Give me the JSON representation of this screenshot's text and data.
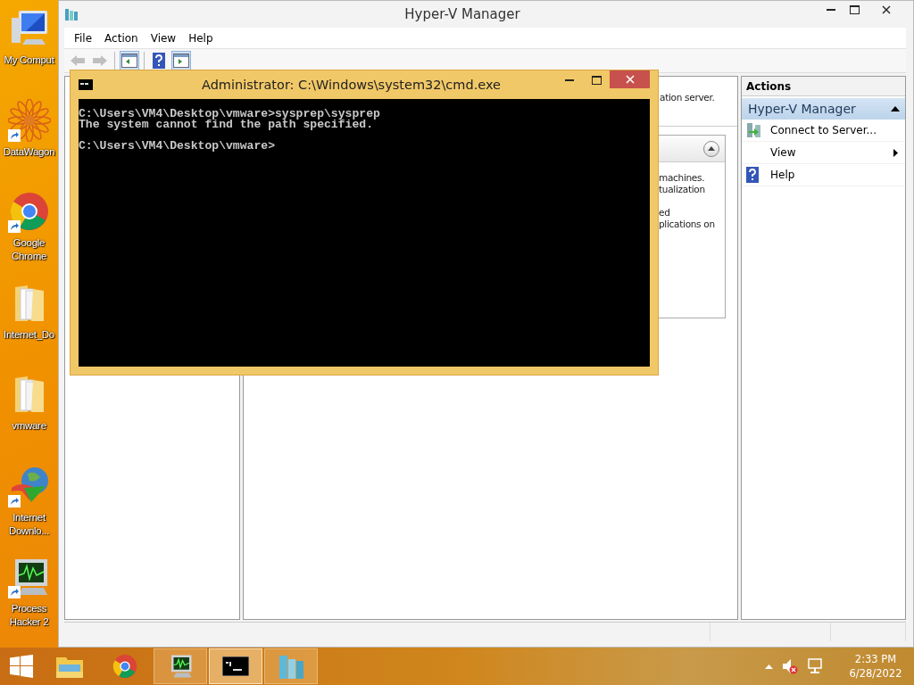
{
  "desktop_icons": [
    {
      "label": "My Comput",
      "kind": "computer",
      "shortcut": false
    },
    {
      "label": "DataWagon",
      "kind": "star",
      "shortcut": true
    },
    {
      "label": "Google Chrome",
      "kind": "chrome",
      "shortcut": true
    },
    {
      "label": "Internet_Do",
      "kind": "folder",
      "shortcut": false
    },
    {
      "label": "vmware",
      "kind": "folder",
      "shortcut": false
    },
    {
      "label": "Internet Downlo...",
      "kind": "globe",
      "shortcut": true
    },
    {
      "label": "Process Hacker 2",
      "kind": "monitor",
      "shortcut": true
    }
  ],
  "window": {
    "title": "Hyper-V Manager",
    "menu": [
      "File",
      "Action",
      "View",
      "Help"
    ],
    "toolbar": [
      {
        "kind": "back",
        "disabled": true
      },
      {
        "kind": "forward",
        "disabled": true
      },
      {
        "kind": "tree",
        "pressed": true
      },
      {
        "kind": "help",
        "pressed": false
      },
      {
        "kind": "pane",
        "pressed": true
      }
    ],
    "center": {
      "top_text": "ation server.",
      "paragraphs": [
        [
          "machines.",
          "tualization"
        ],
        [
          "ed",
          "plications on"
        ]
      ],
      "panel_expanded": true
    },
    "actions": {
      "header": "Actions",
      "group": {
        "title": "Hyper-V Manager",
        "expanded": true
      },
      "items": [
        {
          "label": "Connect to Server...",
          "kind": "connect"
        },
        {
          "label": "View",
          "kind": "submenu"
        },
        {
          "label": "Help",
          "kind": "help"
        }
      ]
    }
  },
  "console": {
    "title": "Administrator: C:\\Windows\\system32\\cmd.exe",
    "blocks": [
      [
        "C:\\Users\\VM4\\Desktop\\vmware>sysprep\\sysprep",
        "The system cannot find the path specified."
      ],
      [
        "C:\\Users\\VM4\\Desktop\\vmware>"
      ]
    ]
  },
  "taskbar": {
    "apps": [
      {
        "kind": "explorer",
        "open": false,
        "selected": false
      },
      {
        "kind": "chrome",
        "open": false,
        "selected": false
      },
      {
        "kind": "monitor",
        "open": true,
        "selected": false
      },
      {
        "kind": "console",
        "open": true,
        "selected": true
      },
      {
        "kind": "servers",
        "open": true,
        "selected": false
      }
    ],
    "clock": {
      "time": "2:33 PM",
      "date": "6/28/2022"
    }
  }
}
